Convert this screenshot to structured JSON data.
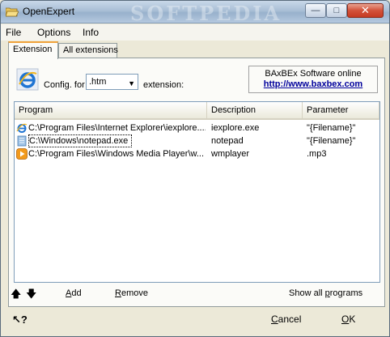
{
  "window": {
    "title": "OpenExpert",
    "watermark": "SOFTPEDIA",
    "minimize_glyph": "—",
    "maximize_glyph": "□",
    "close_glyph": "✕"
  },
  "menu": [
    "File",
    "Options",
    "Info"
  ],
  "tabs": [
    {
      "label": "Extension",
      "active": true
    },
    {
      "label": "All extensions",
      "active": false
    }
  ],
  "extension_panel": {
    "config_label": "Config. for",
    "selected_extension": ".htm",
    "extension_label": "extension:",
    "online": {
      "title": "BAxBEx Software online",
      "link": "http://www.baxbex.com"
    }
  },
  "table": {
    "columns": [
      "Program",
      "Description",
      "Parameter"
    ],
    "rows": [
      {
        "icon": "internet-explorer-icon",
        "program": "C:\\Program Files\\Internet Explorer\\iexplore....",
        "description": "iexplore.exe",
        "parameter": "\"{Filename}\""
      },
      {
        "icon": "notepad-icon",
        "program": "C:\\Windows\\notepad.exe",
        "description": "notepad",
        "parameter": "\"{Filename}\""
      },
      {
        "icon": "media-player-icon",
        "program": "C:\\Program Files\\Windows Media Player\\w...",
        "description": "wmplayer",
        "parameter": ".mp3"
      }
    ]
  },
  "actions": {
    "up_glyph": "🡅",
    "down_glyph": "🡇",
    "add_key": "A",
    "add_rest": "dd",
    "remove_key": "R",
    "remove_rest": "emove",
    "show_all_before": "Show all ",
    "show_all_key": "p",
    "show_all_after": "rograms"
  },
  "footer": {
    "help_glyph": "?",
    "cancel_key": "C",
    "cancel_rest": "ancel",
    "ok_key": "O",
    "ok_rest": "K"
  },
  "colors": {
    "link": "#00009c",
    "tab_accent": "#f0a33b",
    "titlebar": "#a9bfd6"
  }
}
